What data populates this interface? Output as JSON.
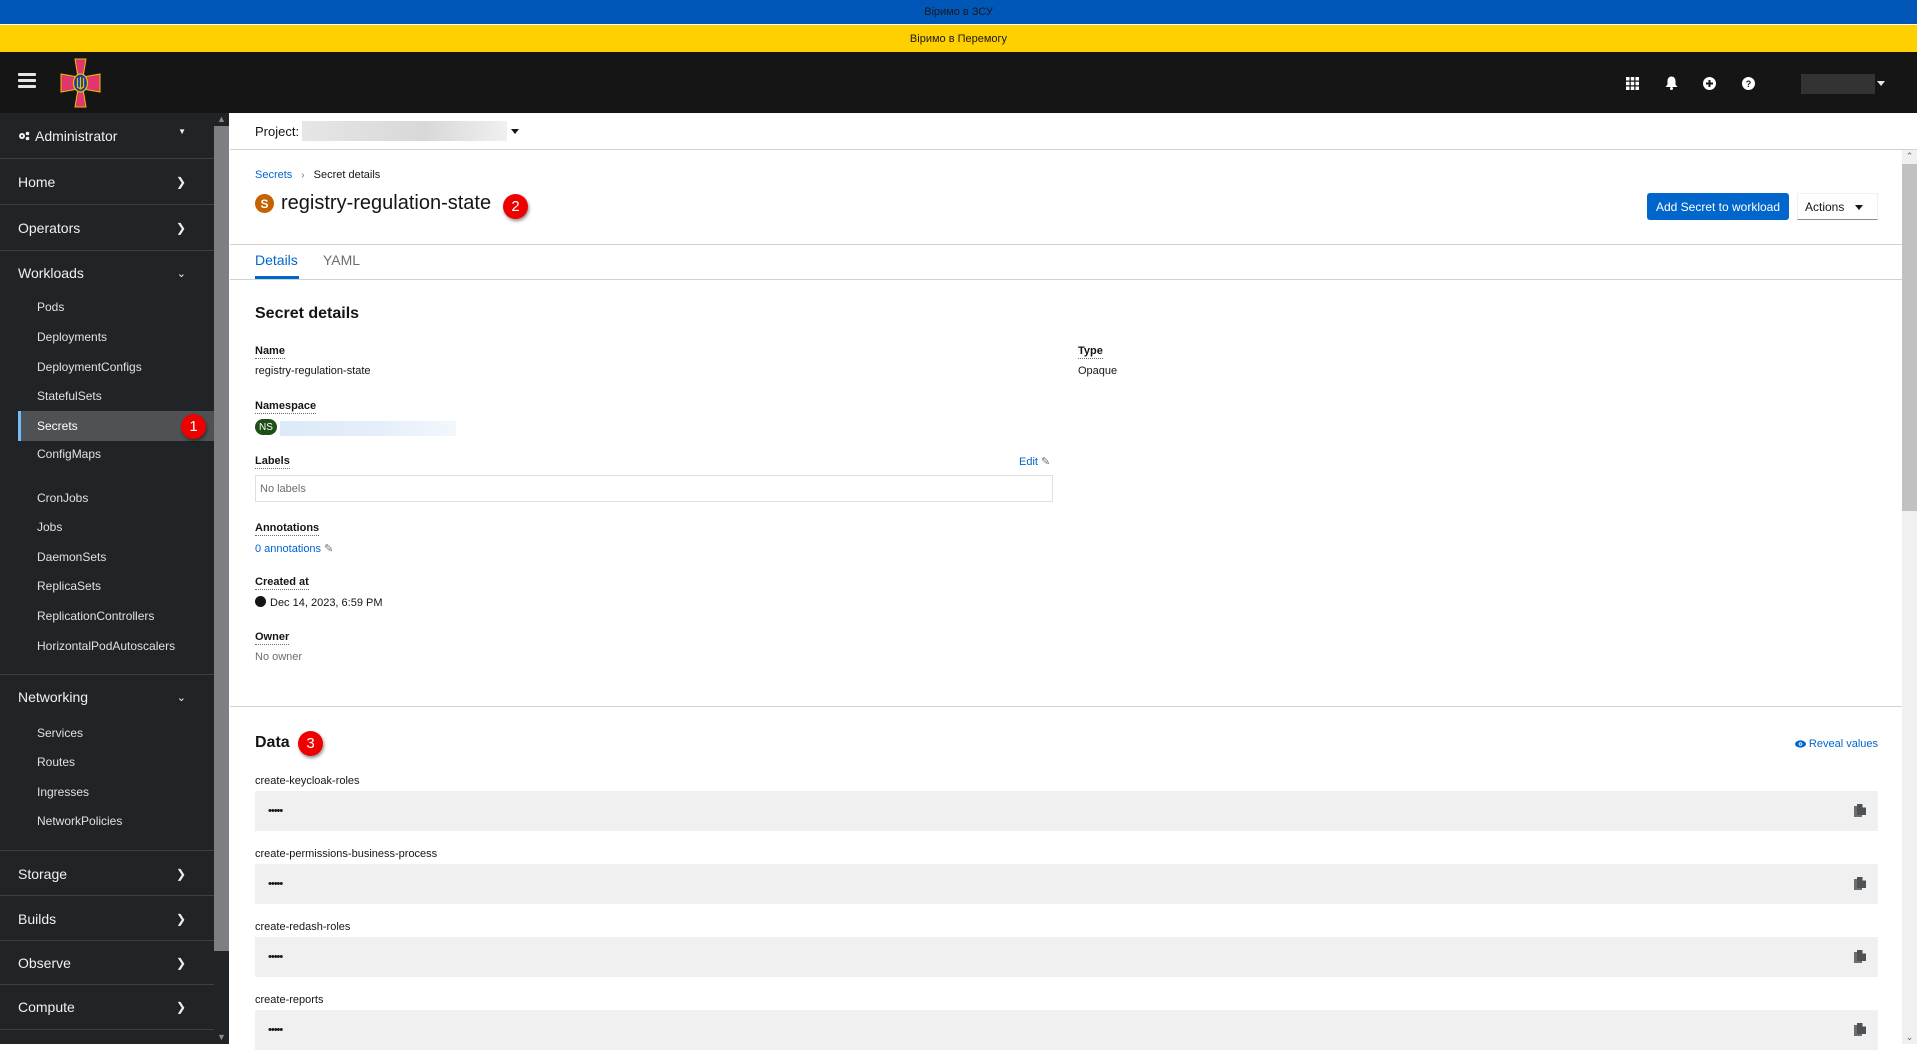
{
  "banners": {
    "top": "Віримо в ЗСУ",
    "bottom": "Віримо в Перемогу"
  },
  "colors": {
    "banner_blue": "#0057b8",
    "banner_yellow": "#ffd000",
    "accent": "#0066cc",
    "annotation_badge": "#ee0000",
    "secret_badge": "#c46100",
    "namespace_badge": "#1e4f18"
  },
  "masthead": {
    "icons": [
      "app-launcher-icon",
      "notifications-icon",
      "add-icon",
      "help-icon"
    ],
    "user_menu": ""
  },
  "sidebar": {
    "perspective": "Administrator",
    "groups": [
      {
        "label": "Home",
        "expanded": false
      },
      {
        "label": "Operators",
        "expanded": false
      },
      {
        "label": "Workloads",
        "expanded": true,
        "items": [
          "Pods",
          "Deployments",
          "DeploymentConfigs",
          "StatefulSets",
          "Secrets",
          "ConfigMaps",
          "CronJobs",
          "Jobs",
          "DaemonSets",
          "ReplicaSets",
          "ReplicationControllers",
          "HorizontalPodAutoscalers"
        ]
      },
      {
        "label": "Networking",
        "expanded": true,
        "items": [
          "Services",
          "Routes",
          "Ingresses",
          "NetworkPolicies"
        ]
      },
      {
        "label": "Storage",
        "expanded": false
      },
      {
        "label": "Builds",
        "expanded": false
      },
      {
        "label": "Observe",
        "expanded": false
      },
      {
        "label": "Compute",
        "expanded": false
      }
    ],
    "active_item": "Secrets"
  },
  "annotations": [
    "1",
    "2",
    "3"
  ],
  "project_bar": {
    "label": "Project:",
    "value": ""
  },
  "breadcrumb": {
    "parent": "Secrets",
    "current": "Secret details"
  },
  "page": {
    "badge": "S",
    "title": "registry-regulation-state",
    "add_button": "Add Secret to workload",
    "actions_button": "Actions",
    "tabs": [
      "Details",
      "YAML"
    ],
    "active_tab": "Details"
  },
  "details": {
    "section_title": "Secret details",
    "name_label": "Name",
    "name_value": "registry-regulation-state",
    "namespace_label": "Namespace",
    "namespace_badge": "NS",
    "namespace_value": "",
    "labels_label": "Labels",
    "labels_edit": "Edit",
    "labels_value": "No labels",
    "annotations_label": "Annotations",
    "annotations_value": "0 annotations",
    "created_label": "Created at",
    "created_value": "Dec 14, 2023, 6:59 PM",
    "owner_label": "Owner",
    "owner_value": "No owner",
    "type_label": "Type",
    "type_value": "Opaque"
  },
  "data_section": {
    "title": "Data",
    "reveal": "Reveal values",
    "entries": [
      {
        "key": "create-keycloak-roles",
        "value": "•••••"
      },
      {
        "key": "create-permissions-business-process",
        "value": "•••••"
      },
      {
        "key": "create-redash-roles",
        "value": "•••••"
      },
      {
        "key": "create-reports",
        "value": "•••••"
      }
    ]
  }
}
